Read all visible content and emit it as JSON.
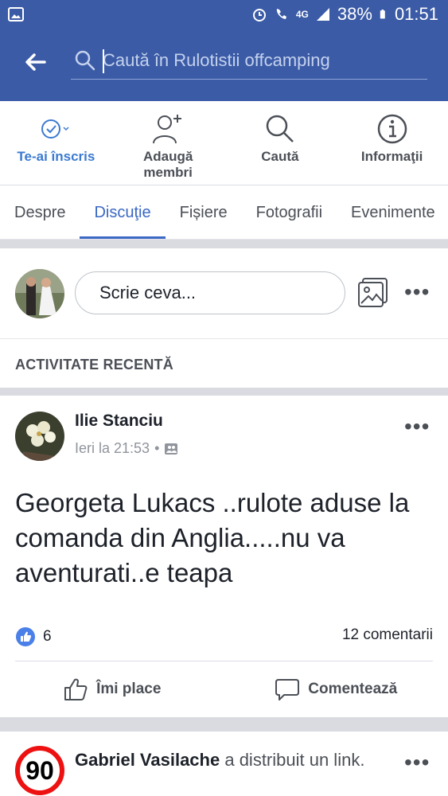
{
  "status_bar": {
    "battery": "38%",
    "time": "01:51",
    "network": "4G"
  },
  "search": {
    "placeholder": "Caută în Rulotistii offcamping"
  },
  "actions": [
    {
      "label": "Te-ai înscris",
      "icon": "check-circle-icon",
      "active": true
    },
    {
      "label": "Adaugă membri",
      "icon": "add-person-icon",
      "active": false
    },
    {
      "label": "Caută",
      "icon": "search-icon",
      "active": false
    },
    {
      "label": "Informaţii",
      "icon": "info-icon",
      "active": false
    }
  ],
  "tabs": [
    {
      "label": "Despre"
    },
    {
      "label": "Discuţie",
      "active": true
    },
    {
      "label": "Fișiere"
    },
    {
      "label": "Fotografii"
    },
    {
      "label": "Evenimente"
    }
  ],
  "composer": {
    "placeholder": "Scrie ceva..."
  },
  "recent_heading": "ACTIVITATE RECENTĂ",
  "post": {
    "author": "Ilie Stanciu",
    "time": "Ieri la 21:53",
    "separator": "•",
    "text": "Georgeta Lukacs ..rulote aduse la comanda din Anglia.....nu va aventurati..e teapa",
    "likes": "6",
    "comments": "12 comentarii",
    "like_label": "Îmi place",
    "comment_label": "Comentează"
  },
  "post2": {
    "author": "Gabriel Vasilache",
    "action": " a distribuit un link.",
    "avatar_text": "90"
  },
  "colors": {
    "brand": "#3b5ba6",
    "accent": "#3b68c4",
    "speed_red": "#e11"
  }
}
